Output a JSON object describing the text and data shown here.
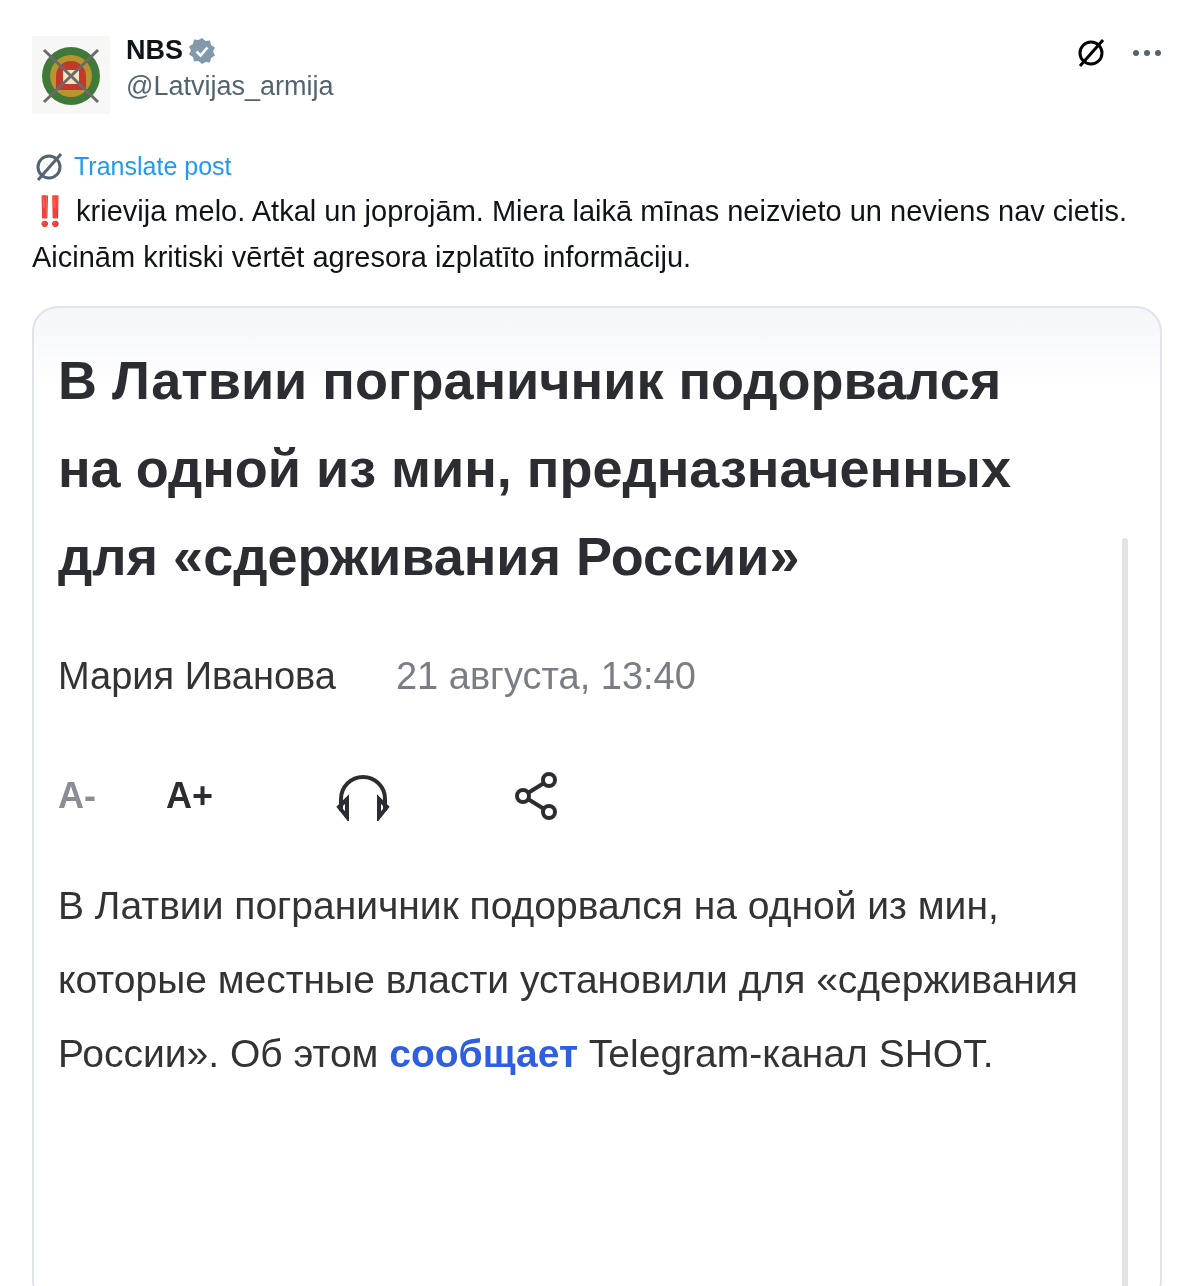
{
  "post": {
    "author": {
      "name": "NBS",
      "verified": true,
      "handle": "@Latvijas_armija"
    },
    "translate_label": "Translate post",
    "emoji": "‼️",
    "text": "krievija melo. Atkal un joprojām. Miera laikā mīnas neizvieto un neviens nav cietis. Aicinām kritiski vērtēt agresora izplatīto informāciju."
  },
  "media": {
    "headline": "В Латвии пограничник подорвался на одной из мин, предназначенных для «сдерживания России»",
    "byline": "Мария Иванова",
    "date": "21 августа, 13:40",
    "font_controls": [
      "A-",
      "A+"
    ],
    "body": [
      {
        "kind": "text",
        "text": "В Латвии пограничник подорвался на одной из мин, которые местные власти установили для «сдерживания России». Об этом "
      },
      {
        "kind": "link",
        "text": "сообщает"
      },
      {
        "kind": "text",
        "text": " Telegram-канал SHOT."
      }
    ]
  }
}
